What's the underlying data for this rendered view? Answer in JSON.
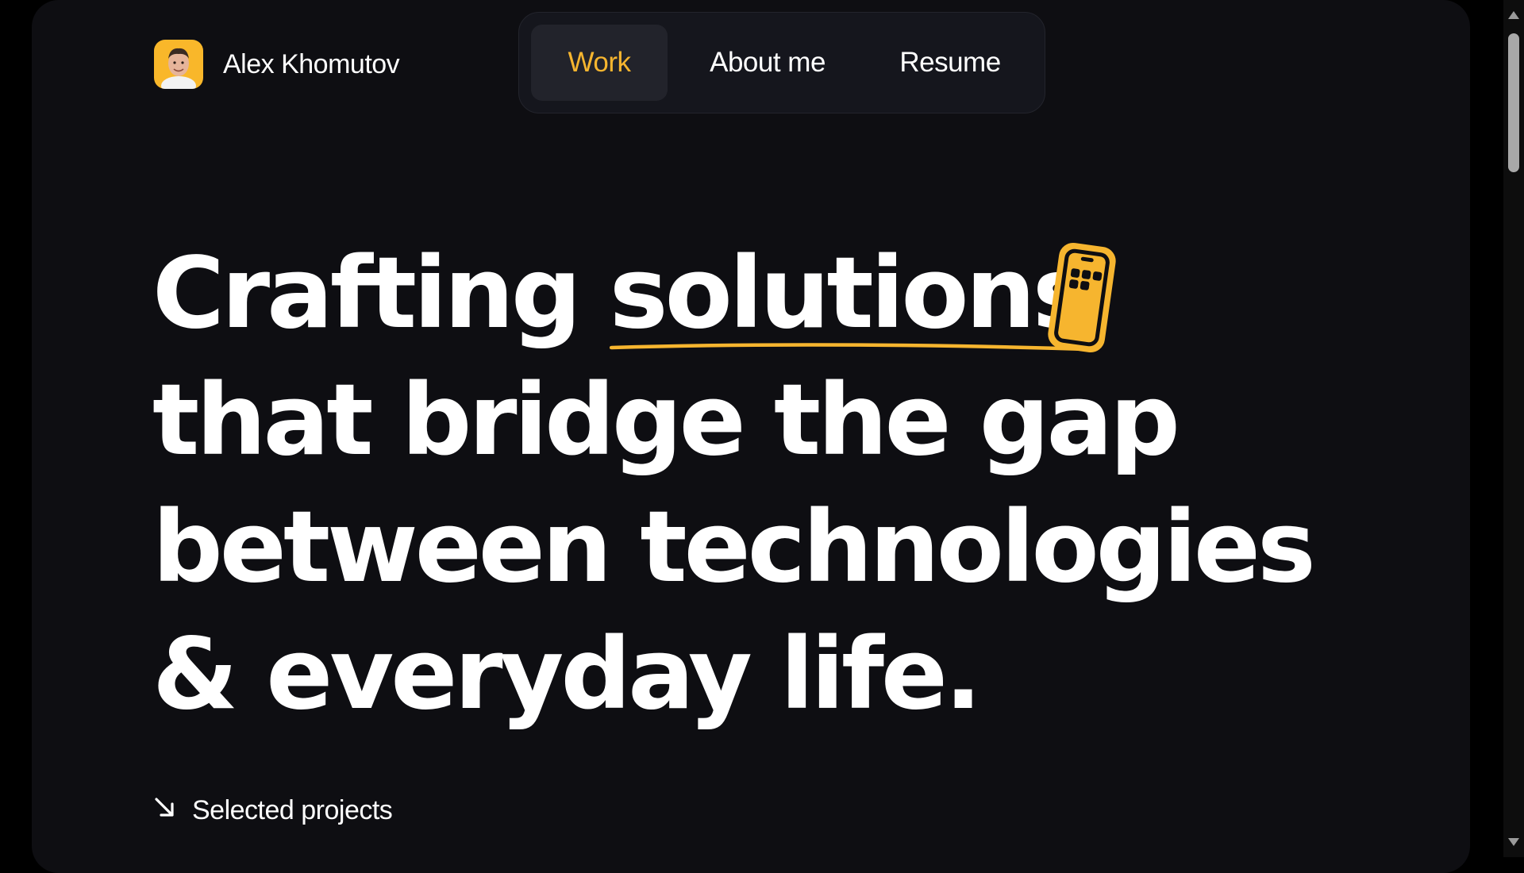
{
  "header": {
    "brand_name": "Alex Khomutov",
    "avatar_icon": "avatar-photo"
  },
  "nav": {
    "items": [
      {
        "label": "Work",
        "active": true
      },
      {
        "label": "About me",
        "active": false
      },
      {
        "label": "Resume",
        "active": false
      }
    ]
  },
  "hero": {
    "line1_word1": "Crafting",
    "line1_highlight": "solutions",
    "line2": "that bridge the gap",
    "line3": "between technologies",
    "line4": "& everyday life.",
    "decoration_icon": "phone-app-grid-icon"
  },
  "selected_projects": {
    "label": "Selected projects",
    "icon": "arrow-down-right-icon"
  },
  "colors": {
    "accent": "#f6b52f",
    "background": "#0e0e12",
    "text": "#ffffff"
  }
}
